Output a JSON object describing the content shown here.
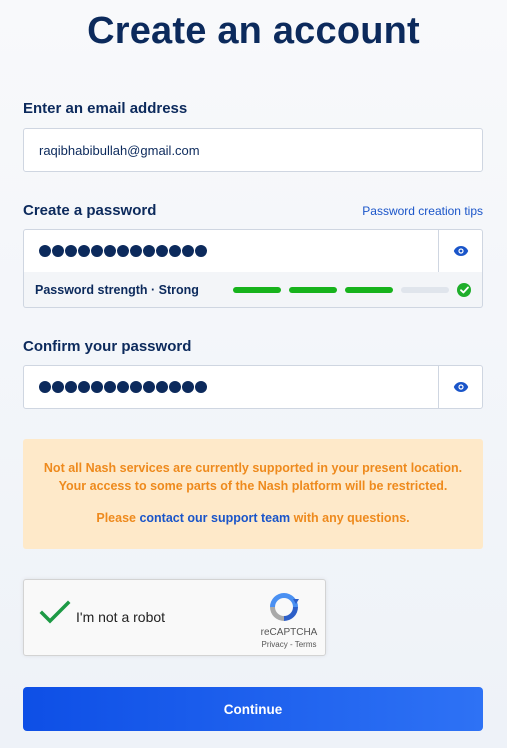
{
  "page": {
    "title": "Create an account"
  },
  "email": {
    "label": "Enter an email address",
    "value": "raqibhabibullah@gmail.com"
  },
  "password": {
    "label": "Create a password",
    "tips_link": "Password creation tips",
    "masked_length": 13,
    "strength_text": "Password strength · Strong",
    "strength_level": 3,
    "strength_max": 4
  },
  "confirm": {
    "label": "Confirm your password",
    "masked_length": 13
  },
  "warning": {
    "line1": "Not all Nash services are currently supported in your present location.",
    "line2": "Your access to some parts of the Nash platform will be restricted.",
    "line3_pre": "Please ",
    "line3_link": "contact our support team",
    "line3_post": " with any questions."
  },
  "recaptcha": {
    "label": "I'm not a robot",
    "brand": "reCAPTCHA",
    "terms": "Privacy - Terms",
    "checked": true
  },
  "actions": {
    "continue_label": "Continue"
  },
  "colors": {
    "primary": "#0e4fe6",
    "navy": "#0c2a5c",
    "strength_green": "#17b31c",
    "warning_bg": "#fee9c9",
    "warning_text": "#ee8a1d",
    "link": "#1a55c9"
  },
  "icons": {
    "reveal": "eye-icon",
    "strength_ok": "check-circle-icon",
    "captcha_check": "checkmark-icon",
    "captcha_logo": "recaptcha-logo-icon"
  }
}
